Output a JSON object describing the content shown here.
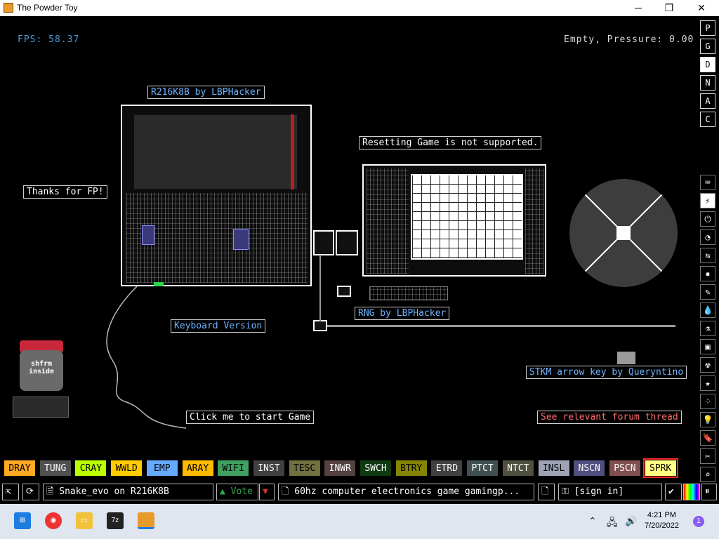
{
  "window": {
    "title": "The Powder Toy",
    "minimize": "─",
    "maximize": "❐",
    "close": "✕"
  },
  "hud": {
    "fps": "FPS: 58.37",
    "status": "Empty, Pressure: 0.00"
  },
  "signs": {
    "r216": "R216K8B by LBPHacker",
    "thanks": "Thanks for FP!",
    "resetting": "Resetting Game is not supported.",
    "keyboard": "Keyboard Version",
    "rng": "RNG by LBPHacker",
    "stkm": "STKM arrow key by Queryntino",
    "click": "Click me to start Game",
    "forum": "See relevant forum thread"
  },
  "logo": {
    "text": "shfrm inside"
  },
  "menu_top": [
    "P",
    "G",
    "D",
    "N",
    "A",
    "C"
  ],
  "menu_top_active": "D",
  "categories": [
    {
      "name": "keyboard-icon",
      "glyph": "⌨"
    },
    {
      "name": "plug-icon",
      "glyph": "⚡"
    },
    {
      "name": "power-icon",
      "glyph": "⏻"
    },
    {
      "name": "gauge-icon",
      "glyph": "◔"
    },
    {
      "name": "arrows-icon",
      "glyph": "⇆"
    },
    {
      "name": "explosion-icon",
      "glyph": "✸"
    },
    {
      "name": "brush-icon",
      "glyph": "✎"
    },
    {
      "name": "drop-icon",
      "glyph": "💧"
    },
    {
      "name": "flask-icon",
      "glyph": "⚗"
    },
    {
      "name": "square-icon",
      "glyph": "▣"
    },
    {
      "name": "radiation-icon",
      "glyph": "☢"
    },
    {
      "name": "star-icon",
      "glyph": "★"
    },
    {
      "name": "dots-icon",
      "glyph": "⁘"
    },
    {
      "name": "bulb-icon",
      "glyph": "💡"
    },
    {
      "name": "bookmark-icon",
      "glyph": "🔖"
    },
    {
      "name": "tools-icon",
      "glyph": "✂"
    },
    {
      "name": "search-icon",
      "glyph": "⌕"
    }
  ],
  "elements": [
    {
      "label": "DRAY",
      "bg": "#ffaa22",
      "fg": "#000000"
    },
    {
      "label": "TUNG",
      "bg": "#505050",
      "fg": "#ffffff"
    },
    {
      "label": "CRAY",
      "bg": "#bbff00",
      "fg": "#000000"
    },
    {
      "label": "WWLD",
      "bg": "#ffcc00",
      "fg": "#000000"
    },
    {
      "label": "EMP",
      "bg": "#66aaff",
      "fg": "#000000"
    },
    {
      "label": "ARAY",
      "bg": "#ffbb00",
      "fg": "#000000"
    },
    {
      "label": "WIFI",
      "bg": "#40a060",
      "fg": "#000000"
    },
    {
      "label": "INST",
      "bg": "#404040",
      "fg": "#ffffff"
    },
    {
      "label": "TESC",
      "bg": "#707040",
      "fg": "#000000"
    },
    {
      "label": "INWR",
      "bg": "#544141",
      "fg": "#ffffff"
    },
    {
      "label": "SWCH",
      "bg": "#103b11",
      "fg": "#ffffff"
    },
    {
      "label": "BTRY",
      "bg": "#858505",
      "fg": "#000000"
    },
    {
      "label": "ETRD",
      "bg": "#404040",
      "fg": "#ffffff"
    },
    {
      "label": "PTCT",
      "bg": "#405050",
      "fg": "#ffffff"
    },
    {
      "label": "NTCT",
      "bg": "#505040",
      "fg": "#ffffff"
    },
    {
      "label": "INSL",
      "bg": "#9ea3b6",
      "fg": "#000000"
    },
    {
      "label": "NSCN",
      "bg": "#505080",
      "fg": "#ffffff"
    },
    {
      "label": "PSCN",
      "bg": "#805050",
      "fg": "#ffffff"
    },
    {
      "label": "SPRK",
      "bg": "#ffff80",
      "fg": "#000000"
    }
  ],
  "selected_element": "SPRK",
  "bottombar": {
    "save_name": "Snake_evo on R216K8B",
    "vote": "Vote",
    "tags": "60hz computer electronics game gamingp...",
    "signin": "[sign in]"
  },
  "taskbar": {
    "time": "4:21 PM",
    "date": "7/20/2022",
    "notifications": "1",
    "zip_label": "7z"
  }
}
